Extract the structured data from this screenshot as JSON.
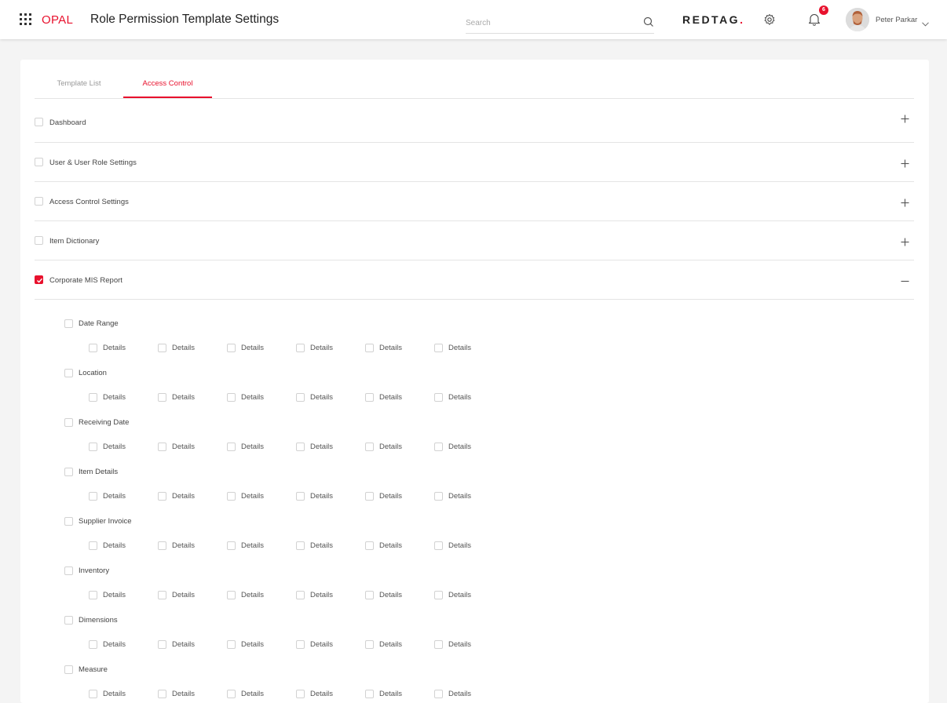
{
  "header": {
    "logo": "OPAL",
    "title": "Role Permission Template Settings",
    "search_placeholder": "Search",
    "brand_name": "REDTAG",
    "brand_dot": ".",
    "notification_count": "6",
    "user_name": "Peter Parkar",
    "accent_color": "#e8112d"
  },
  "tabs": [
    {
      "label": "Template List",
      "active": false
    },
    {
      "label": "Access Control",
      "active": true
    }
  ],
  "sections": [
    {
      "label": "Dashboard",
      "checked": false,
      "expanded": false
    },
    {
      "label": "User & User Role Settings",
      "checked": false,
      "expanded": false
    },
    {
      "label": "Access Control Settings",
      "checked": false,
      "expanded": false
    },
    {
      "label": "Item Dictionary",
      "checked": false,
      "expanded": false
    },
    {
      "label": "Corporate MIS Report",
      "checked": true,
      "expanded": true
    }
  ],
  "sub_items": [
    {
      "label": "Date Range",
      "details": [
        "Details",
        "Details",
        "Details",
        "Details",
        "Details",
        "Details"
      ]
    },
    {
      "label": "Location",
      "details": [
        "Details",
        "Details",
        "Details",
        "Details",
        "Details",
        "Details"
      ]
    },
    {
      "label": "Receiving Date",
      "details": [
        "Details",
        "Details",
        "Details",
        "Details",
        "Details",
        "Details"
      ]
    },
    {
      "label": "Item Details",
      "details": [
        "Details",
        "Details",
        "Details",
        "Details",
        "Details",
        "Details"
      ]
    },
    {
      "label": "Supplier Invoice",
      "details": [
        "Details",
        "Details",
        "Details",
        "Details",
        "Details",
        "Details"
      ]
    },
    {
      "label": "Inventory",
      "details": [
        "Details",
        "Details",
        "Details",
        "Details",
        "Details",
        "Details"
      ]
    },
    {
      "label": "Dimensions",
      "details": [
        "Details",
        "Details",
        "Details",
        "Details",
        "Details",
        "Details"
      ]
    },
    {
      "label": "Measure",
      "details": [
        "Details",
        "Details",
        "Details",
        "Details",
        "Details",
        "Details"
      ]
    }
  ]
}
